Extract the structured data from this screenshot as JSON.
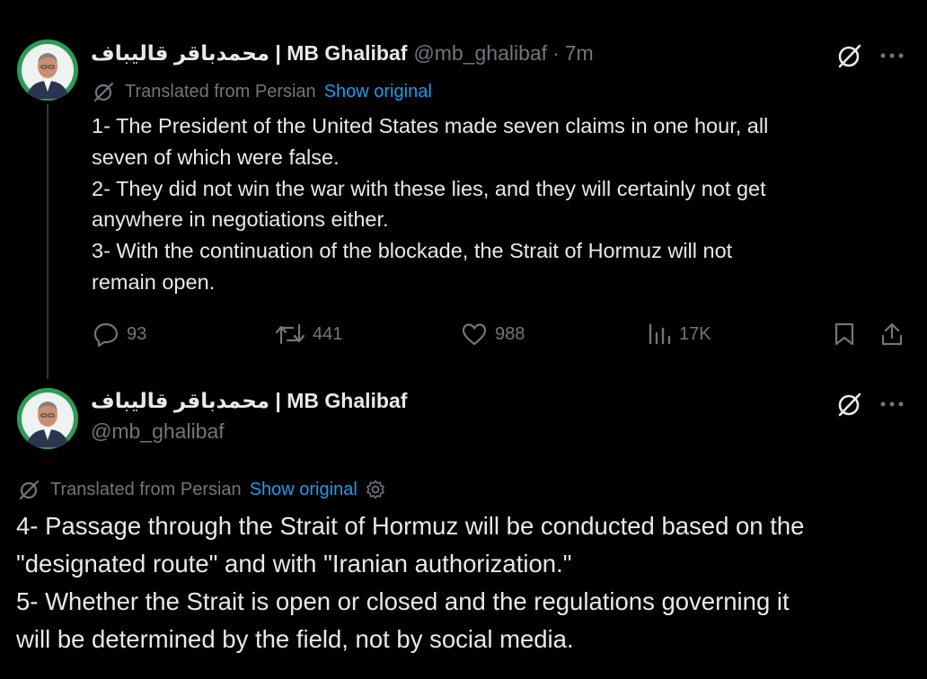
{
  "tweet1": {
    "display_name": "محمدباقر قالیباف | MB Ghalibaf",
    "handle": "@mb_ghalibaf",
    "separator": "·",
    "time": "7m",
    "translated_label": "Translated from Persian",
    "show_original": "Show original",
    "body_lines": [
      "1- The President of the United States made seven claims in one hour, all",
      "seven of which were false.",
      "2- They did not win the war with these lies, and they will certainly not get",
      "anywhere in negotiations either.",
      "3- With the continuation of the blockade, the Strait of Hormuz will not",
      "remain open."
    ],
    "replies": "93",
    "reposts": "441",
    "likes": "988",
    "views": "17K"
  },
  "tweet2": {
    "display_name": "محمدباقر قالیباف | MB Ghalibaf",
    "handle": "@mb_ghalibaf",
    "translated_label": "Translated from Persian",
    "show_original": "Show original",
    "body_lines": [
      "4- Passage through the Strait of Hormuz will be conducted based on the",
      "\"designated route\" and with \"Iranian authorization.\"",
      "5- Whether the Strait is open or closed and the regulations governing it",
      "will be determined by the field, not by social media."
    ]
  },
  "icons": {
    "grok": "grok-icon",
    "more": "more-icon",
    "translate": "translate-icon",
    "settings": "gear-icon",
    "reply": "reply-icon",
    "repost": "repost-icon",
    "like": "heart-icon",
    "views": "views-icon",
    "bookmark": "bookmark-icon",
    "share": "share-icon"
  },
  "colors": {
    "background": "#000000",
    "text": "#e7e9ea",
    "muted": "#71767b",
    "link": "#1d9bf0",
    "avatar_bg": "#2e9a57"
  }
}
